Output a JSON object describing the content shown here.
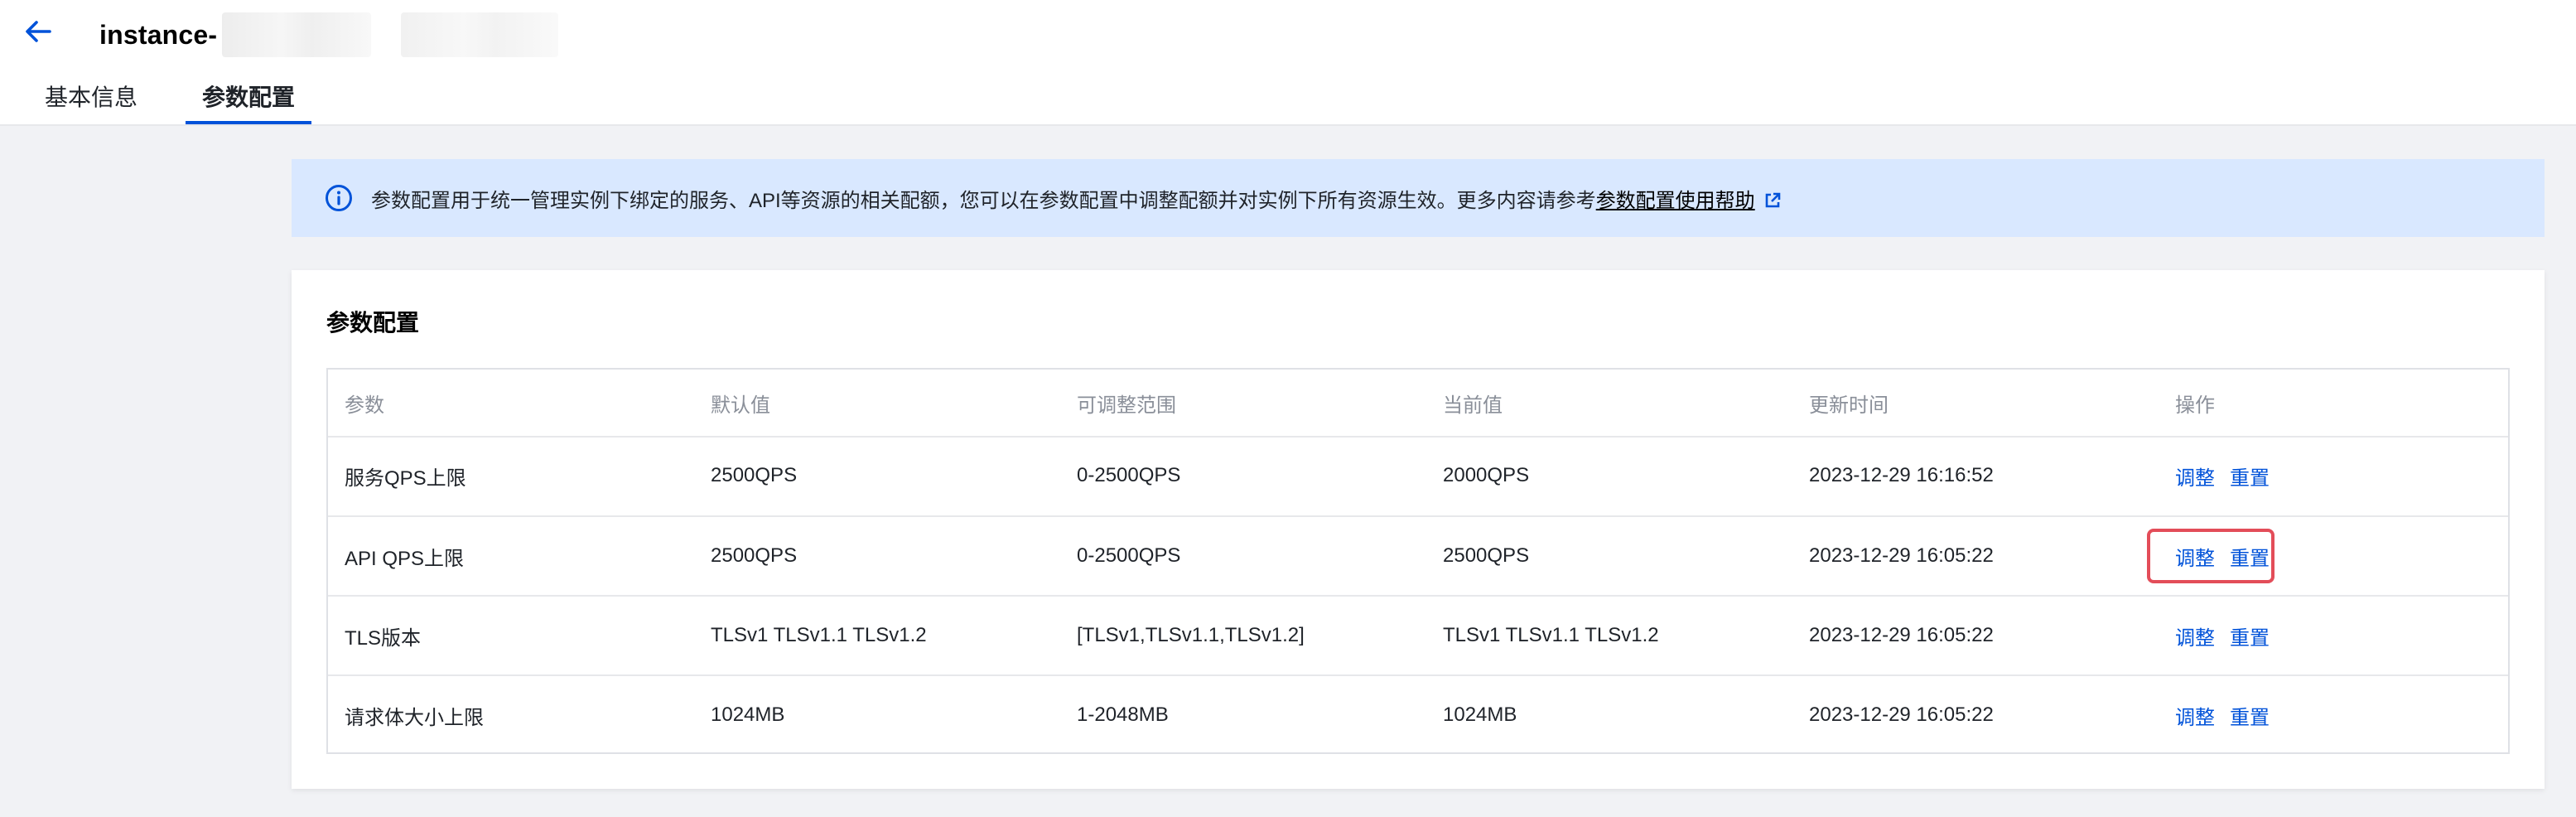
{
  "header": {
    "title": "instance-",
    "back_icon": "arrow-left-icon"
  },
  "tabs": [
    {
      "label": "基本信息",
      "active": false
    },
    {
      "label": "参数配置",
      "active": true
    }
  ],
  "notice": {
    "text": "参数配置用于统一管理实例下绑定的服务、API等资源的相关配额，您可以在参数配置中调整配额并对实例下所有资源生效。更多内容请参考",
    "link_text": "参数配置使用帮助",
    "icon": "info-icon",
    "link_icon": "external-link-icon"
  },
  "card": {
    "title": "参数配置",
    "columns": [
      "参数",
      "默认值",
      "可调整范围",
      "当前值",
      "更新时间",
      "操作"
    ],
    "rows": [
      {
        "param": "服务QPS上限",
        "default": "2500QPS",
        "range": "0-2500QPS",
        "current": "2000QPS",
        "updated": "2023-12-29 16:16:52",
        "adjust": "调整",
        "reset": "重置"
      },
      {
        "param": "API QPS上限",
        "default": "2500QPS",
        "range": "0-2500QPS",
        "current": "2500QPS",
        "updated": "2023-12-29 16:05:22",
        "adjust": "调整",
        "reset": "重置"
      },
      {
        "param": "TLS版本",
        "default": "TLSv1 TLSv1.1 TLSv1.2",
        "range": "[TLSv1,TLSv1.1,TLSv1.2]",
        "current": "TLSv1 TLSv1.1 TLSv1.2",
        "updated": "2023-12-29 16:05:22",
        "adjust": "调整",
        "reset": "重置"
      },
      {
        "param": "请求体大小上限",
        "default": "1024MB",
        "range": "1-2048MB",
        "current": "1024MB",
        "updated": "2023-12-29 16:05:22",
        "adjust": "调整",
        "reset": "重置"
      }
    ]
  },
  "colors": {
    "primary": "#0052d9",
    "notice_bg": "#d9e8ff",
    "highlight": "#e34d59",
    "page_bg": "#f1f2f5"
  }
}
